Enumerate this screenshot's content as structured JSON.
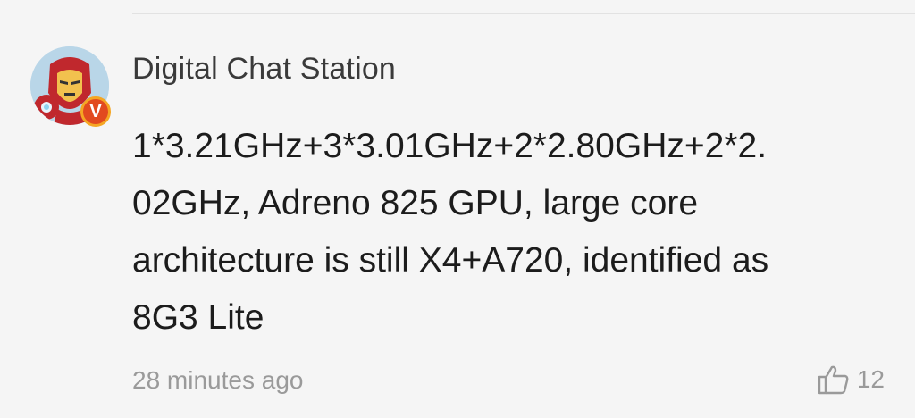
{
  "comment": {
    "author": "Digital Chat Station",
    "verified_badge": "V",
    "lines": [
      "1*3.21GHz+3*3.01GHz+2*2.80GHz+2*2.",
      "02GHz, Adreno 825 GPU, large core",
      "architecture is still X4+A720, identified as",
      "8G3 Lite"
    ],
    "time": "28 minutes ago",
    "like_count": "12",
    "like_icon": "thumbs-up-icon"
  },
  "colors": {
    "background": "#f5f5f5",
    "text": "#1c1c1c",
    "muted": "#9a9a9a",
    "badge": "#e24a1f"
  }
}
